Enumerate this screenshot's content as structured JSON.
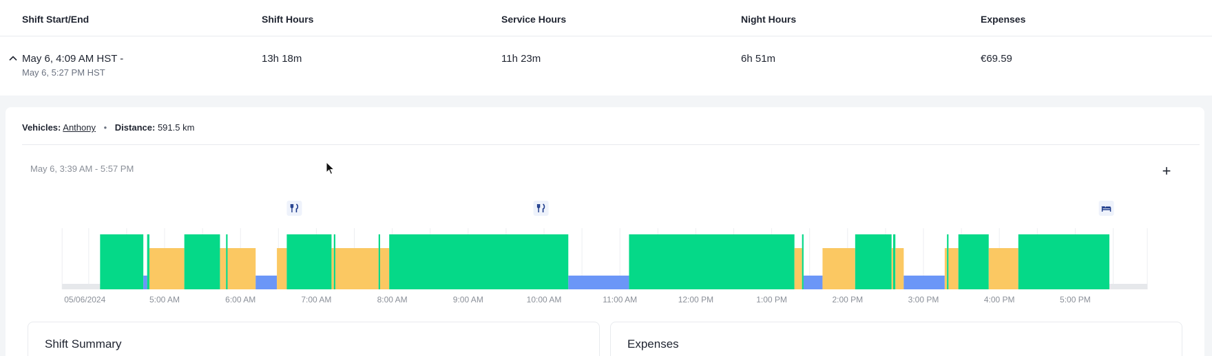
{
  "table": {
    "headers": [
      "Shift Start/End",
      "Shift Hours",
      "Service Hours",
      "Night Hours",
      "Expenses"
    ],
    "row": {
      "start": "May 6, 4:09 AM HST -",
      "end": "May 6, 5:27 PM HST",
      "shift_hours": "13h 18m",
      "service_hours": "11h 23m",
      "night_hours": "6h 51m",
      "expenses": "€69.59"
    }
  },
  "details": {
    "vehicles_label": "Vehicles:",
    "vehicle_name": "Anthony",
    "separator": "•",
    "distance_label": "Distance:",
    "distance_value": "591.5 km",
    "timeline_range": "May 6, 3:39 AM - 5:57 PM",
    "zoom_label": "+"
  },
  "timeline": {
    "start_hour": 3.65,
    "end hour": 17.95,
    "tick_labels": [
      "05/06/2024",
      "5:00 AM",
      "6:00 AM",
      "7:00 AM",
      "8:00 AM",
      "9:00 AM",
      "10:00 AM",
      "11:00 AM",
      "12:00 PM",
      "1:00 PM",
      "2:00 PM",
      "3:00 PM",
      "4:00 PM",
      "5:00 PM"
    ],
    "tick_hours": [
      3.65,
      5,
      6,
      7,
      8,
      9,
      10,
      11,
      12,
      13,
      14,
      15,
      16,
      17
    ],
    "colors": {
      "driving": "#05d988",
      "on_duty": "#fbc862",
      "off_duty": "#6b96f7",
      "base": "#e6e8eb"
    },
    "segments": [
      {
        "status": "driving",
        "start": 4.15,
        "end": 4.72
      },
      {
        "status": "off_duty",
        "start": 4.72,
        "end": 4.77
      },
      {
        "status": "driving",
        "start": 4.77,
        "end": 4.8
      },
      {
        "status": "on_duty",
        "start": 4.8,
        "end": 5.26
      },
      {
        "status": "driving",
        "start": 5.26,
        "end": 5.73
      },
      {
        "status": "on_duty",
        "start": 5.73,
        "end": 5.81
      },
      {
        "status": "driving",
        "start": 5.81,
        "end": 5.83
      },
      {
        "status": "on_duty",
        "start": 5.83,
        "end": 6.2
      },
      {
        "status": "off_duty",
        "start": 6.2,
        "end": 6.48
      },
      {
        "status": "on_duty",
        "start": 6.48,
        "end": 6.61
      },
      {
        "status": "driving",
        "start": 6.61,
        "end": 7.2
      },
      {
        "status": "on_duty",
        "start": 7.2,
        "end": 7.23
      },
      {
        "status": "driving",
        "start": 7.23,
        "end": 7.25
      },
      {
        "status": "on_duty",
        "start": 7.25,
        "end": 7.82
      },
      {
        "status": "driving",
        "start": 7.82,
        "end": 7.84
      },
      {
        "status": "on_duty",
        "start": 7.84,
        "end": 7.96
      },
      {
        "status": "driving",
        "start": 7.96,
        "end": 10.32
      },
      {
        "status": "off_duty",
        "start": 10.32,
        "end": 11.12
      },
      {
        "status": "driving",
        "start": 11.12,
        "end": 13.3
      },
      {
        "status": "on_duty",
        "start": 13.3,
        "end": 13.4
      },
      {
        "status": "driving",
        "start": 13.4,
        "end": 13.42
      },
      {
        "status": "off_duty",
        "start": 13.42,
        "end": 13.67
      },
      {
        "status": "on_duty",
        "start": 13.67,
        "end": 14.1
      },
      {
        "status": "driving",
        "start": 14.1,
        "end": 14.58
      },
      {
        "status": "on_duty",
        "start": 14.58,
        "end": 14.6
      },
      {
        "status": "driving",
        "start": 14.6,
        "end": 14.63
      },
      {
        "status": "on_duty",
        "start": 14.63,
        "end": 14.74
      },
      {
        "status": "off_duty",
        "start": 14.74,
        "end": 15.28
      },
      {
        "status": "on_duty",
        "start": 15.28,
        "end": 15.31
      },
      {
        "status": "driving",
        "start": 15.31,
        "end": 15.33
      },
      {
        "status": "on_duty",
        "start": 15.33,
        "end": 15.46
      },
      {
        "status": "driving",
        "start": 15.46,
        "end": 15.86
      },
      {
        "status": "on_duty",
        "start": 15.86,
        "end": 16.25
      },
      {
        "status": "driving",
        "start": 16.25,
        "end": 17.45
      }
    ],
    "markers": [
      {
        "icon": "meal-icon",
        "hour": 6.71
      },
      {
        "icon": "meal-icon",
        "hour": 9.96
      },
      {
        "icon": "sleeper-berth-icon",
        "hour": 17.41
      }
    ]
  },
  "cards": {
    "summary_title": "Shift Summary",
    "expenses_title": "Expenses"
  }
}
